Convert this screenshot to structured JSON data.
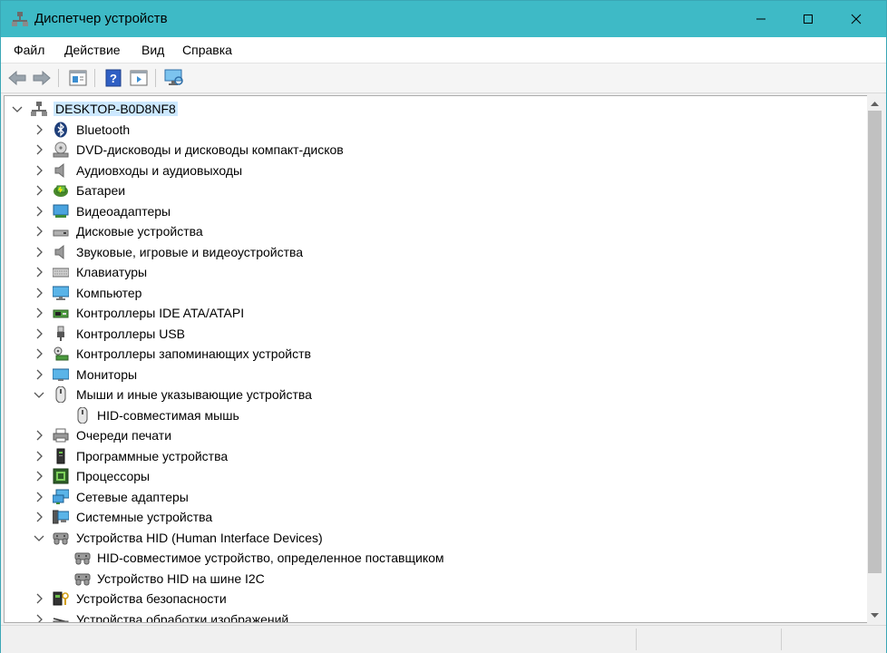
{
  "window": {
    "title": "Диспетчер устройств",
    "accent": "#3ebac6"
  },
  "menu": [
    "Файл",
    "Действие",
    "Вид",
    "Справка"
  ],
  "toolbar": [
    "back-arrow-icon",
    "forward-arrow-icon",
    "properties-icon",
    "help-icon",
    "update-driver-icon",
    "scan-hardware-icon"
  ],
  "tree": {
    "root": "DESKTOP-B0D8NF8",
    "items": [
      {
        "label": "Bluetooth",
        "icon": "bluetooth-icon",
        "expanded": false
      },
      {
        "label": "DVD-дисководы и дисководы компакт-дисков",
        "icon": "dvd-drive-icon",
        "expanded": false
      },
      {
        "label": "Аудиовходы и аудиовыходы",
        "icon": "speaker-icon",
        "expanded": false
      },
      {
        "label": "Батареи",
        "icon": "battery-icon",
        "expanded": false
      },
      {
        "label": "Видеоадаптеры",
        "icon": "display-adapter-icon",
        "expanded": false
      },
      {
        "label": "Дисковые устройства",
        "icon": "disk-drive-icon",
        "expanded": false
      },
      {
        "label": "Звуковые, игровые и видеоустройства",
        "icon": "sound-icon",
        "expanded": false
      },
      {
        "label": "Клавиатуры",
        "icon": "keyboard-icon",
        "expanded": false
      },
      {
        "label": "Компьютер",
        "icon": "computer-icon",
        "expanded": false
      },
      {
        "label": "Контроллеры IDE ATA/ATAPI",
        "icon": "ide-controller-icon",
        "expanded": false
      },
      {
        "label": "Контроллеры USB",
        "icon": "usb-icon",
        "expanded": false
      },
      {
        "label": "Контроллеры запоминающих устройств",
        "icon": "storage-controller-icon",
        "expanded": false
      },
      {
        "label": "Мониторы",
        "icon": "monitor-icon",
        "expanded": false
      },
      {
        "label": "Мыши и иные указывающие устройства",
        "icon": "mouse-icon",
        "expanded": true,
        "children": [
          {
            "label": "HID-совместимая мышь",
            "icon": "mouse-icon"
          }
        ]
      },
      {
        "label": "Очереди печати",
        "icon": "printer-icon",
        "expanded": false
      },
      {
        "label": "Программные устройства",
        "icon": "software-device-icon",
        "expanded": false
      },
      {
        "label": "Процессоры",
        "icon": "processor-icon",
        "expanded": false
      },
      {
        "label": "Сетевые адаптеры",
        "icon": "network-adapter-icon",
        "expanded": false
      },
      {
        "label": "Системные устройства",
        "icon": "system-device-icon",
        "expanded": false
      },
      {
        "label": "Устройства HID (Human Interface Devices)",
        "icon": "hid-icon",
        "expanded": true,
        "children": [
          {
            "label": "HID-совместимое устройство, определенное поставщиком",
            "icon": "hid-icon"
          },
          {
            "label": "Устройство HID на шине I2C",
            "icon": "hid-icon"
          }
        ]
      },
      {
        "label": "Устройства безопасности",
        "icon": "security-device-icon",
        "expanded": false
      },
      {
        "label": "Устройства обработки изображений",
        "icon": "imaging-device-icon",
        "expanded": false
      }
    ]
  }
}
